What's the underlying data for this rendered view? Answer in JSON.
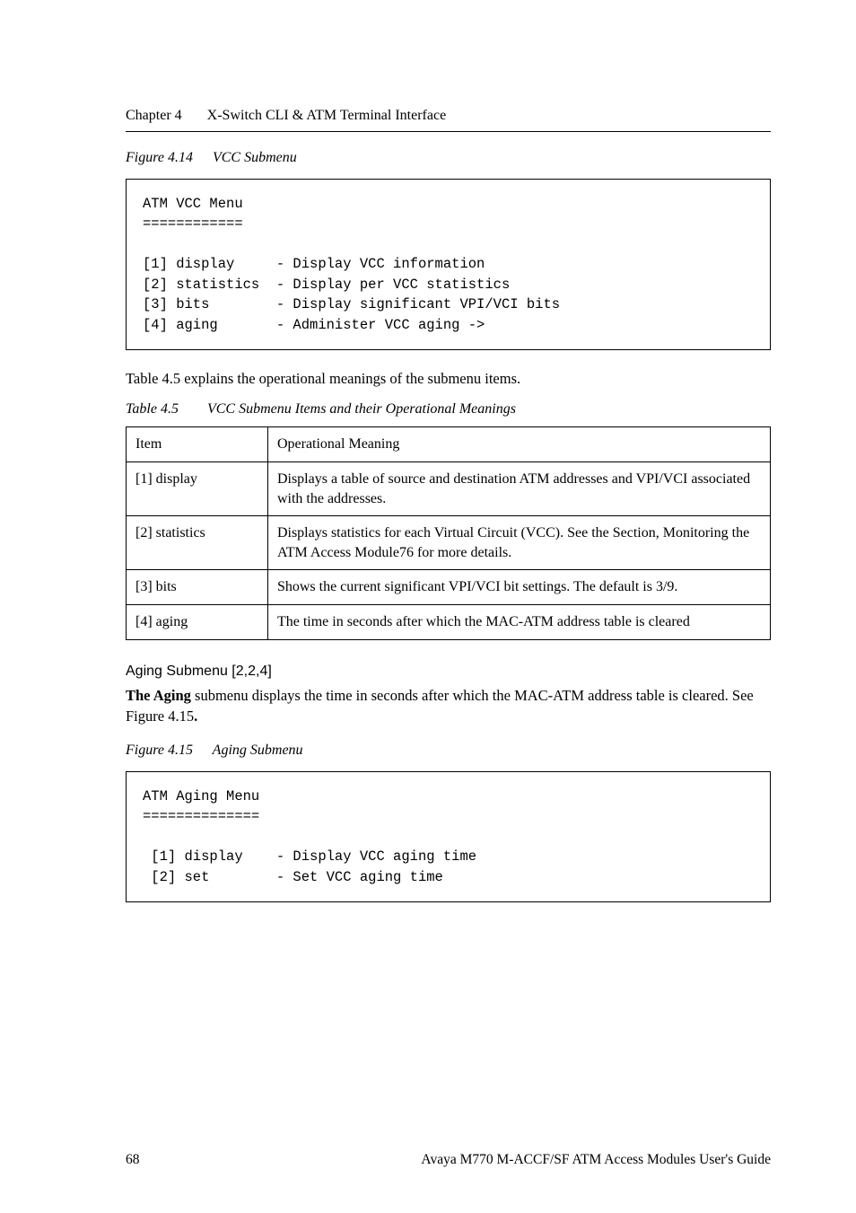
{
  "header": {
    "chapter": "Chapter 4",
    "title": "X-Switch CLI & ATM Terminal Interface"
  },
  "figure414": {
    "label": "Figure 4.14",
    "caption": "VCC Submenu",
    "code": "ATM VCC Menu\n============\n\n[1] display     - Display VCC information\n[2] statistics  - Display per VCC statistics\n[3] bits        - Display significant VPI/VCI bits\n[4] aging       - Administer VCC aging ->"
  },
  "para1": "Table 4.5 explains the operational meanings of the submenu items.",
  "table45": {
    "label": "Table 4.5",
    "caption": "VCC Submenu Items and their Operational Meanings",
    "col1_header": "Item",
    "col2_header": "Operational Meaning",
    "rows": [
      {
        "item": "[1] display",
        "meaning": "Displays a table of source and destination ATM addresses and  VPI/VCI associated with the addresses."
      },
      {
        "item": "[2] statistics",
        "meaning": "Displays statistics for each Virtual Circuit (VCC). See the Section, Monitoring the ATM Access Module76 for more details."
      },
      {
        "item": "[3] bits",
        "meaning": "Shows the current significant VPI/VCI bit settings. The default is 3/9."
      },
      {
        "item": "[4] aging",
        "meaning": "The time in seconds after which the MAC-ATM address table is cleared"
      }
    ]
  },
  "subheading": "Aging Submenu [2,2,4]",
  "para2_a": "The Aging",
  "para2_b": " submenu displays the time in seconds after which the MAC-ATM address table is cleared. See Figure 4.15",
  "para2_c": ".",
  "figure415": {
    "label": "Figure 4.15",
    "caption": "Aging Submenu",
    "code": "ATM Aging Menu\n==============\n\n [1] display    - Display VCC aging time\n [2] set        - Set VCC aging time"
  },
  "footer": {
    "page": "68",
    "doc_title": "Avaya M770 M-ACCF/SF ATM Access Modules User's Guide"
  }
}
